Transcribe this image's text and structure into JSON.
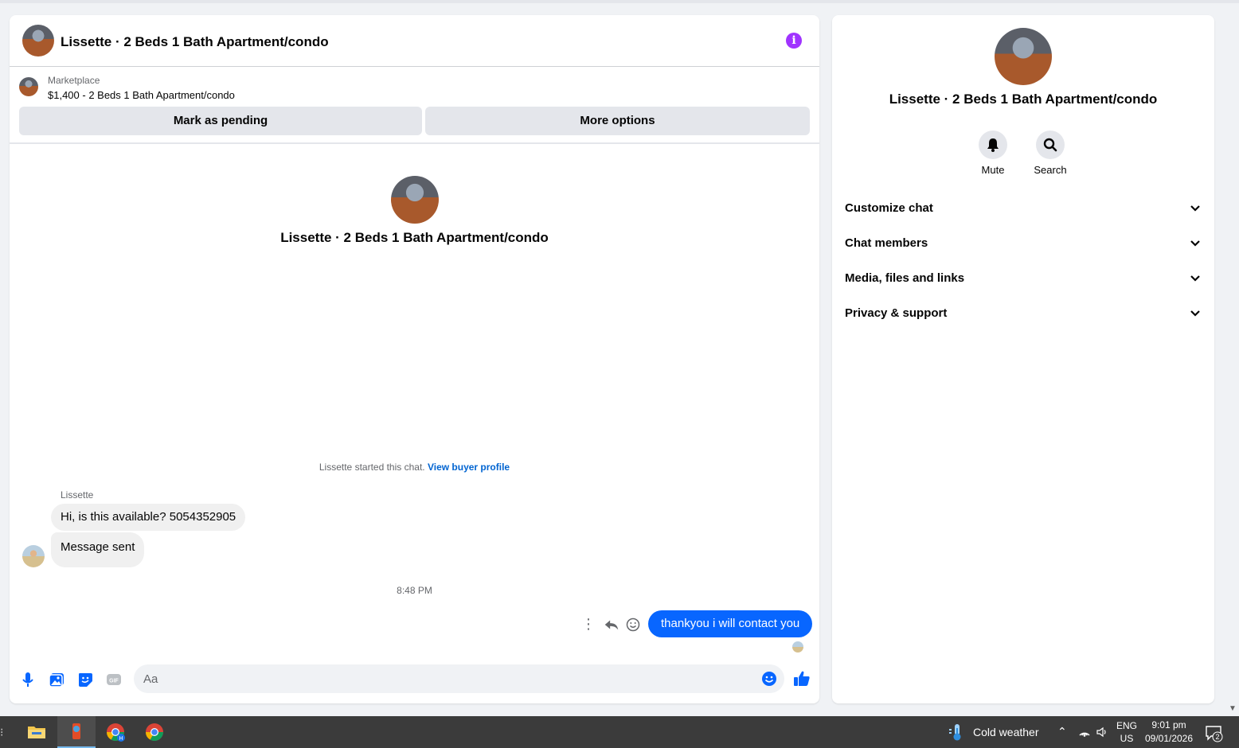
{
  "chat": {
    "title": "Lissette · 2 Beds 1 Bath Apartment/condo",
    "marketplace_label": "Marketplace",
    "listing": "$1,400 - 2 Beds 1 Bath Apartment/condo",
    "mark_pending_label": "Mark as pending",
    "more_options_label": "More options",
    "started_text": "Lissette started this chat.",
    "view_buyer_label": "View buyer profile",
    "sender_name": "Lissette",
    "messages": [
      {
        "from": "Lissette",
        "text": "Hi, is this available? 5054352905"
      },
      {
        "from": "Lissette",
        "text": "Message sent"
      },
      {
        "from": "me",
        "text": "thankyou i will contact you"
      }
    ],
    "timestamp": "8:48 PM",
    "composer_placeholder": "Aa",
    "icons": [
      "info-icon",
      "more-icon",
      "reply-icon",
      "react-icon",
      "mic-icon",
      "photo-icon",
      "sticker-icon",
      "gif-icon",
      "emoji-icon",
      "like-icon"
    ],
    "accent_color": "#0866ff",
    "info_color": "#a033ff"
  },
  "right_panel": {
    "title": "Lissette · 2 Beds 1 Bath Apartment/condo",
    "actions": [
      {
        "label": "Mute",
        "icon": "bell-icon"
      },
      {
        "label": "Search",
        "icon": "search-icon"
      }
    ],
    "sections": [
      "Customize chat",
      "Chat members",
      "Media, files and links",
      "Privacy & support"
    ]
  },
  "taskbar": {
    "apps": [
      "file-explorer-icon",
      "app-icon",
      "chrome-icon",
      "chrome-icon"
    ],
    "weather": "Cold weather",
    "lang_top": "ENG",
    "lang_bottom": "US",
    "time": "9:01 pm",
    "date": "09/01/2026",
    "notification_count": "2"
  }
}
